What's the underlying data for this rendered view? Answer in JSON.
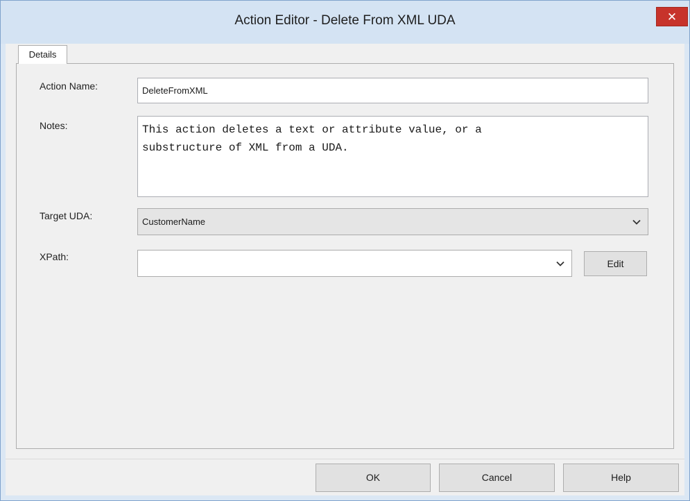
{
  "window": {
    "title": "Action Editor - Delete From XML UDA",
    "close_glyph": "✕"
  },
  "tabs": [
    {
      "label": "Details"
    }
  ],
  "form": {
    "action_name_label": "Action Name:",
    "action_name_value": "DeleteFromXML",
    "notes_label": "Notes:",
    "notes_value": "This action deletes a text or attribute value, or a\nsubstructure of XML from a UDA.",
    "target_uda_label": "Target UDA:",
    "target_uda_value": "CustomerName",
    "xpath_label": "XPath:",
    "xpath_value": "",
    "edit_button": "Edit"
  },
  "buttons": {
    "ok": "OK",
    "cancel": "Cancel",
    "help": "Help"
  },
  "icons": {
    "close": "close-icon",
    "dropdown": "chevron-down-icon"
  },
  "colors": {
    "close_button": "#c7332b",
    "titlebar": "#d4e3f3",
    "client": "#f0f0f0"
  }
}
